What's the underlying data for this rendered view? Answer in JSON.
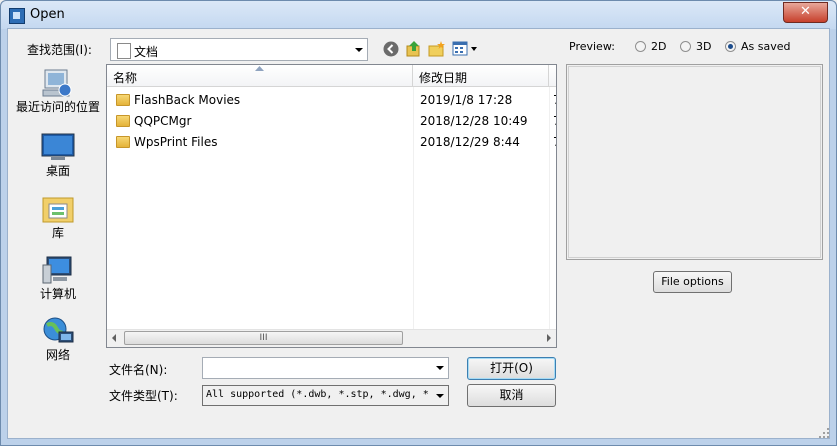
{
  "window": {
    "title": "Open",
    "close_glyph": "✕"
  },
  "lookin": {
    "label": "查找范围(I):",
    "value": "文档"
  },
  "places": [
    {
      "label": "最近访问的位置",
      "icon": "recent-places-icon"
    },
    {
      "label": "桌面",
      "icon": "desktop-icon"
    },
    {
      "label": "库",
      "icon": "libraries-icon"
    },
    {
      "label": "计算机",
      "icon": "computer-icon"
    },
    {
      "label": "网络",
      "icon": "network-icon"
    }
  ],
  "columns": {
    "name": "名称",
    "date": "修改日期"
  },
  "files": [
    {
      "name": "FlashBack Movies",
      "date": "2019/1/8 17:28",
      "cut": "7"
    },
    {
      "name": "QQPCMgr",
      "date": "2018/12/28 10:49",
      "cut": "7"
    },
    {
      "name": "WpsPrint Files",
      "date": "2018/12/29 8:44",
      "cut": "7"
    }
  ],
  "scroll_grip": "III",
  "filename": {
    "label": "文件名(N):",
    "value": ""
  },
  "filetype": {
    "label": "文件类型(T):",
    "value": "All supported (*.dwb, *.stp, *.dwg, *"
  },
  "buttons": {
    "open": "打开(O)",
    "cancel": "取消",
    "file_options": "File options"
  },
  "preview": {
    "label": "Preview:",
    "options": [
      {
        "label": "2D",
        "selected": false
      },
      {
        "label": "3D",
        "selected": false
      },
      {
        "label": "As saved",
        "selected": true
      }
    ]
  }
}
